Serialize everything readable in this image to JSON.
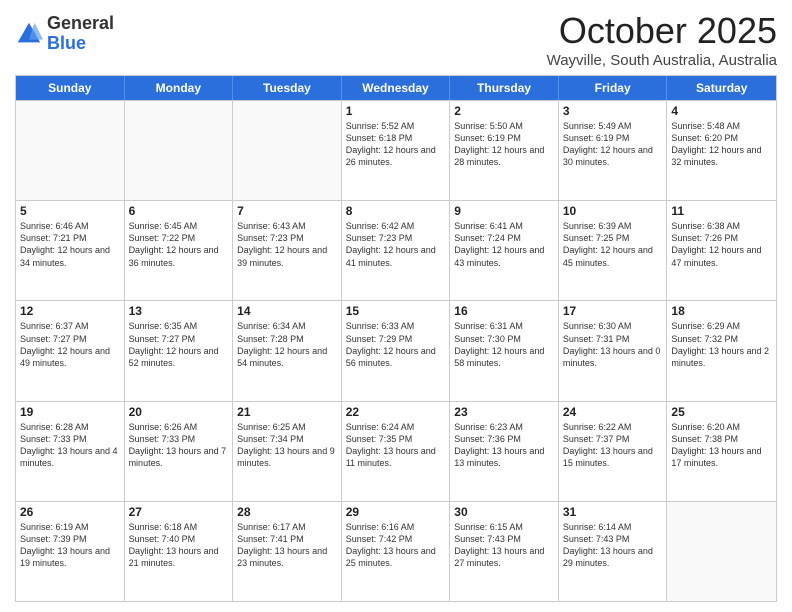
{
  "header": {
    "logo_general": "General",
    "logo_blue": "Blue",
    "month": "October 2025",
    "location": "Wayville, South Australia, Australia"
  },
  "days": [
    "Sunday",
    "Monday",
    "Tuesday",
    "Wednesday",
    "Thursday",
    "Friday",
    "Saturday"
  ],
  "weeks": [
    [
      {
        "day": "",
        "empty": true
      },
      {
        "day": "",
        "empty": true
      },
      {
        "day": "",
        "empty": true
      },
      {
        "day": "1",
        "sunrise": "Sunrise: 5:52 AM",
        "sunset": "Sunset: 6:18 PM",
        "daylight": "Daylight: 12 hours and 26 minutes."
      },
      {
        "day": "2",
        "sunrise": "Sunrise: 5:50 AM",
        "sunset": "Sunset: 6:19 PM",
        "daylight": "Daylight: 12 hours and 28 minutes."
      },
      {
        "day": "3",
        "sunrise": "Sunrise: 5:49 AM",
        "sunset": "Sunset: 6:19 PM",
        "daylight": "Daylight: 12 hours and 30 minutes."
      },
      {
        "day": "4",
        "sunrise": "Sunrise: 5:48 AM",
        "sunset": "Sunset: 6:20 PM",
        "daylight": "Daylight: 12 hours and 32 minutes."
      }
    ],
    [
      {
        "day": "5",
        "sunrise": "Sunrise: 6:46 AM",
        "sunset": "Sunset: 7:21 PM",
        "daylight": "Daylight: 12 hours and 34 minutes."
      },
      {
        "day": "6",
        "sunrise": "Sunrise: 6:45 AM",
        "sunset": "Sunset: 7:22 PM",
        "daylight": "Daylight: 12 hours and 36 minutes."
      },
      {
        "day": "7",
        "sunrise": "Sunrise: 6:43 AM",
        "sunset": "Sunset: 7:23 PM",
        "daylight": "Daylight: 12 hours and 39 minutes."
      },
      {
        "day": "8",
        "sunrise": "Sunrise: 6:42 AM",
        "sunset": "Sunset: 7:23 PM",
        "daylight": "Daylight: 12 hours and 41 minutes."
      },
      {
        "day": "9",
        "sunrise": "Sunrise: 6:41 AM",
        "sunset": "Sunset: 7:24 PM",
        "daylight": "Daylight: 12 hours and 43 minutes."
      },
      {
        "day": "10",
        "sunrise": "Sunrise: 6:39 AM",
        "sunset": "Sunset: 7:25 PM",
        "daylight": "Daylight: 12 hours and 45 minutes."
      },
      {
        "day": "11",
        "sunrise": "Sunrise: 6:38 AM",
        "sunset": "Sunset: 7:26 PM",
        "daylight": "Daylight: 12 hours and 47 minutes."
      }
    ],
    [
      {
        "day": "12",
        "sunrise": "Sunrise: 6:37 AM",
        "sunset": "Sunset: 7:27 PM",
        "daylight": "Daylight: 12 hours and 49 minutes."
      },
      {
        "day": "13",
        "sunrise": "Sunrise: 6:35 AM",
        "sunset": "Sunset: 7:27 PM",
        "daylight": "Daylight: 12 hours and 52 minutes."
      },
      {
        "day": "14",
        "sunrise": "Sunrise: 6:34 AM",
        "sunset": "Sunset: 7:28 PM",
        "daylight": "Daylight: 12 hours and 54 minutes."
      },
      {
        "day": "15",
        "sunrise": "Sunrise: 6:33 AM",
        "sunset": "Sunset: 7:29 PM",
        "daylight": "Daylight: 12 hours and 56 minutes."
      },
      {
        "day": "16",
        "sunrise": "Sunrise: 6:31 AM",
        "sunset": "Sunset: 7:30 PM",
        "daylight": "Daylight: 12 hours and 58 minutes."
      },
      {
        "day": "17",
        "sunrise": "Sunrise: 6:30 AM",
        "sunset": "Sunset: 7:31 PM",
        "daylight": "Daylight: 13 hours and 0 minutes."
      },
      {
        "day": "18",
        "sunrise": "Sunrise: 6:29 AM",
        "sunset": "Sunset: 7:32 PM",
        "daylight": "Daylight: 13 hours and 2 minutes."
      }
    ],
    [
      {
        "day": "19",
        "sunrise": "Sunrise: 6:28 AM",
        "sunset": "Sunset: 7:33 PM",
        "daylight": "Daylight: 13 hours and 4 minutes."
      },
      {
        "day": "20",
        "sunrise": "Sunrise: 6:26 AM",
        "sunset": "Sunset: 7:33 PM",
        "daylight": "Daylight: 13 hours and 7 minutes."
      },
      {
        "day": "21",
        "sunrise": "Sunrise: 6:25 AM",
        "sunset": "Sunset: 7:34 PM",
        "daylight": "Daylight: 13 hours and 9 minutes."
      },
      {
        "day": "22",
        "sunrise": "Sunrise: 6:24 AM",
        "sunset": "Sunset: 7:35 PM",
        "daylight": "Daylight: 13 hours and 11 minutes."
      },
      {
        "day": "23",
        "sunrise": "Sunrise: 6:23 AM",
        "sunset": "Sunset: 7:36 PM",
        "daylight": "Daylight: 13 hours and 13 minutes."
      },
      {
        "day": "24",
        "sunrise": "Sunrise: 6:22 AM",
        "sunset": "Sunset: 7:37 PM",
        "daylight": "Daylight: 13 hours and 15 minutes."
      },
      {
        "day": "25",
        "sunrise": "Sunrise: 6:20 AM",
        "sunset": "Sunset: 7:38 PM",
        "daylight": "Daylight: 13 hours and 17 minutes."
      }
    ],
    [
      {
        "day": "26",
        "sunrise": "Sunrise: 6:19 AM",
        "sunset": "Sunset: 7:39 PM",
        "daylight": "Daylight: 13 hours and 19 minutes."
      },
      {
        "day": "27",
        "sunrise": "Sunrise: 6:18 AM",
        "sunset": "Sunset: 7:40 PM",
        "daylight": "Daylight: 13 hours and 21 minutes."
      },
      {
        "day": "28",
        "sunrise": "Sunrise: 6:17 AM",
        "sunset": "Sunset: 7:41 PM",
        "daylight": "Daylight: 13 hours and 23 minutes."
      },
      {
        "day": "29",
        "sunrise": "Sunrise: 6:16 AM",
        "sunset": "Sunset: 7:42 PM",
        "daylight": "Daylight: 13 hours and 25 minutes."
      },
      {
        "day": "30",
        "sunrise": "Sunrise: 6:15 AM",
        "sunset": "Sunset: 7:43 PM",
        "daylight": "Daylight: 13 hours and 27 minutes."
      },
      {
        "day": "31",
        "sunrise": "Sunrise: 6:14 AM",
        "sunset": "Sunset: 7:43 PM",
        "daylight": "Daylight: 13 hours and 29 minutes."
      },
      {
        "day": "",
        "empty": true
      }
    ]
  ]
}
